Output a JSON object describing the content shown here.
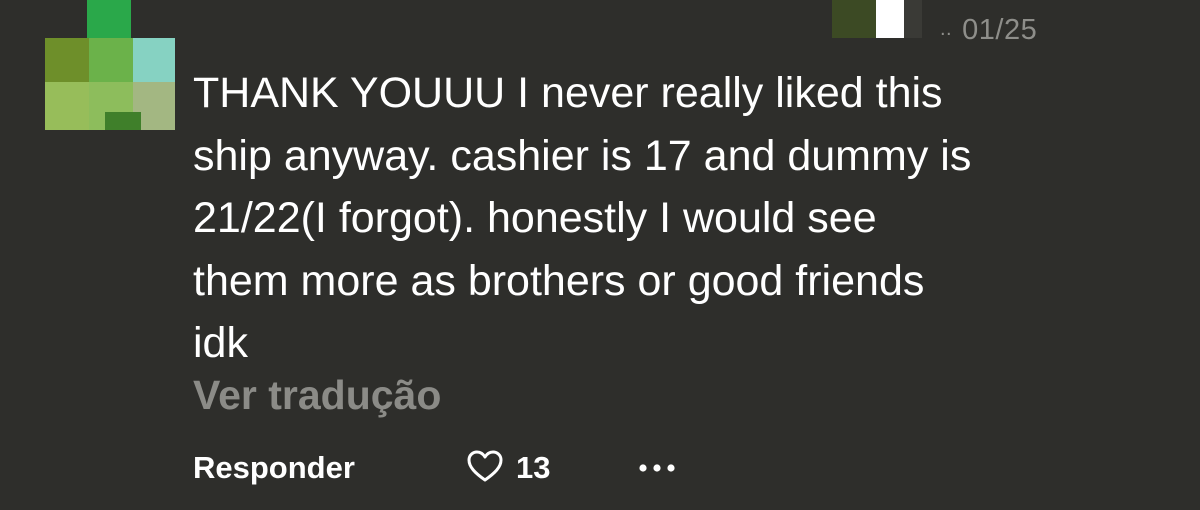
{
  "comment": {
    "date": "01/25",
    "username_hidden": "..",
    "text": "THANK YOUUU I never really liked this\nship anyway. cashier is 17 and dummy is\n21/22(I forgot). honestly I would see\nthem more as brothers or good friends\nidk",
    "translate_label": "Ver tradução"
  },
  "actions": {
    "reply_label": "Responder",
    "like_count": "13"
  },
  "icons": {
    "like": "heart-outline-icon",
    "more": "more-dots-icon"
  },
  "colors": {
    "background": "#2e2e2b",
    "text": "#ffffff",
    "muted": "#8b8b87"
  }
}
